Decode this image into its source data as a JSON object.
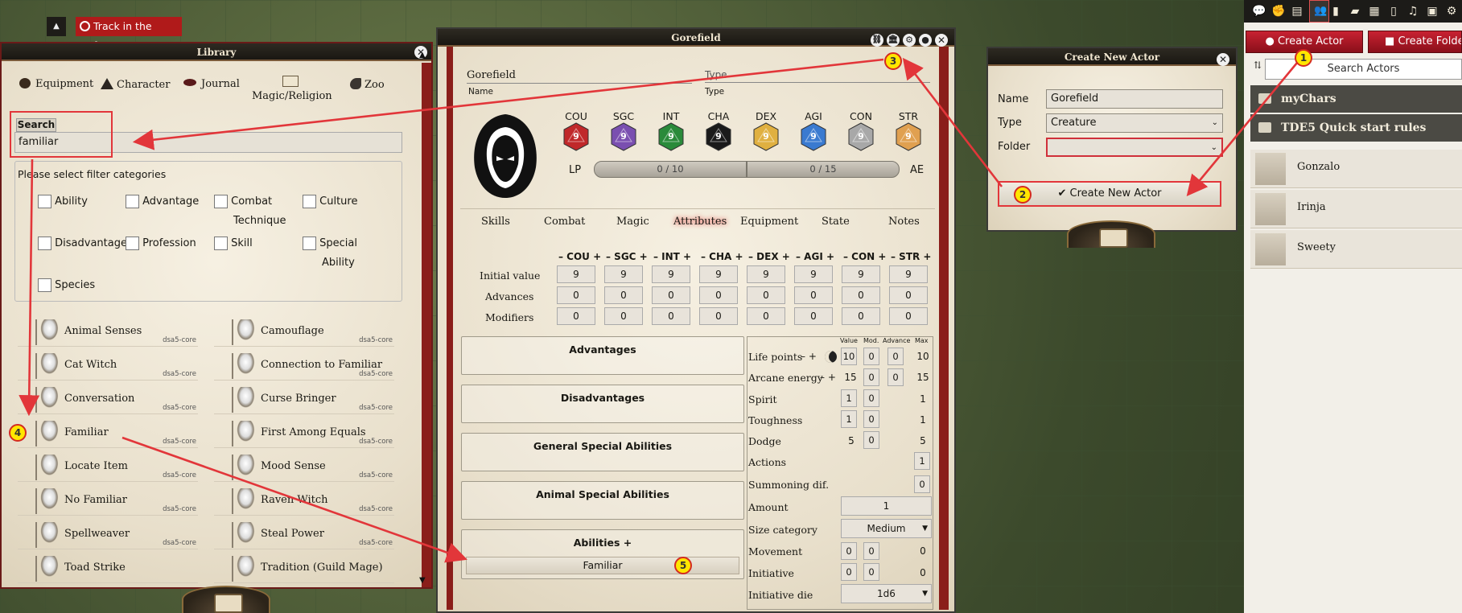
{
  "topbar": {
    "scene_tab": "Track in the forest",
    "collapse": "▲"
  },
  "library": {
    "title": "Library",
    "categories": [
      "Equipment",
      "Character",
      "Journal",
      "Magic/Religion",
      "Zoo"
    ],
    "search_label": "Search",
    "search_value": "familiar",
    "filter_title": "Please select filter categories",
    "filters": [
      "Ability",
      "Advantage",
      "Combat",
      "Technique",
      "Culture",
      "Disadvantage",
      "Profession",
      "Skill",
      "Special",
      "Ability",
      "Species"
    ],
    "items": [
      {
        "name": "Animal Senses",
        "src": "dsa5-core"
      },
      {
        "name": "Camouflage",
        "src": "dsa5-core"
      },
      {
        "name": "Cat Witch",
        "src": "dsa5-core"
      },
      {
        "name": "Connection to Familiar",
        "src": "dsa5-core"
      },
      {
        "name": "Conversation",
        "src": "dsa5-core"
      },
      {
        "name": "Curse Bringer",
        "src": "dsa5-core"
      },
      {
        "name": "Familiar",
        "src": "dsa5-core"
      },
      {
        "name": "First Among Equals",
        "src": "dsa5-core"
      },
      {
        "name": "Locate Item",
        "src": "dsa5-core"
      },
      {
        "name": "Mood Sense",
        "src": "dsa5-core"
      },
      {
        "name": "No Familiar",
        "src": "dsa5-core"
      },
      {
        "name": "Raven Witch",
        "src": "dsa5-core"
      },
      {
        "name": "Spellweaver",
        "src": "dsa5-core"
      },
      {
        "name": "Steal Power",
        "src": "dsa5-core"
      },
      {
        "name": "Toad Strike",
        "src": ""
      },
      {
        "name": "Tradition (Guild Mage)",
        "src": ""
      }
    ]
  },
  "sheet": {
    "title": "Gorefield",
    "name_value": "Gorefield",
    "name_label": "Name",
    "type_value": "Type",
    "type_label": "Type",
    "attrs": [
      "COU",
      "SGC",
      "INT",
      "CHA",
      "DEX",
      "AGI",
      "CON",
      "STR"
    ],
    "die_value": "9",
    "die_colors": [
      "#c0282a",
      "#7a4fb0",
      "#2a8a3a",
      "#1a1a1a",
      "#e0b040",
      "#3a7ad0",
      "#a8a8a8",
      "#e0a050"
    ],
    "lp_label": "LP",
    "ae_label": "AE",
    "lp_bar": "0 / 10",
    "ae_bar": "0 / 15",
    "tabs": [
      "Skills",
      "Combat",
      "Magic",
      "Attributes",
      "Equipment",
      "State",
      "Notes"
    ],
    "attr_headers": [
      "– COU +",
      "– SGC +",
      "– INT +",
      "– CHA +",
      "– DEX +",
      "– AGI +",
      "– CON +",
      "– STR +"
    ],
    "row_labels": [
      "Initial value",
      "Advances",
      "Modifiers"
    ],
    "initial": [
      "9",
      "9",
      "9",
      "9",
      "9",
      "9",
      "9",
      "9"
    ],
    "advances": [
      "0",
      "0",
      "0",
      "0",
      "0",
      "0",
      "0",
      "0"
    ],
    "modifiers": [
      "0",
      "0",
      "0",
      "0",
      "0",
      "0",
      "0",
      "0"
    ],
    "sections": [
      "Advantages",
      "Disadvantages",
      "General Special Abilities",
      "Animal Special Abilities",
      "Abilities +"
    ],
    "ability_item": "Familiar",
    "stat_heads": [
      "Value",
      "Mod.",
      "Advance",
      "Max"
    ],
    "stats": {
      "life": {
        "label": "Life points",
        "ctl": "– +",
        "value": "10",
        "mod": "0",
        "adv": "0",
        "max": "10"
      },
      "arcane": {
        "label": "Arcane energy",
        "ctl": "– +",
        "value": "15",
        "mod": "0",
        "adv": "0",
        "max": "15"
      },
      "spirit": {
        "label": "Spirit",
        "value": "1",
        "mod": "0",
        "max": "1"
      },
      "tough": {
        "label": "Toughness",
        "value": "1",
        "mod": "0",
        "max": "1"
      },
      "dodge": {
        "label": "Dodge",
        "value": "5",
        "mod": "0",
        "max": "5"
      },
      "actions": {
        "label": "Actions",
        "value": "1"
      },
      "summon": {
        "label": "Summoning dif.",
        "value": "0"
      },
      "amount": {
        "label": "Amount",
        "value": "1"
      },
      "size": {
        "label": "Size category",
        "value": "Medium"
      },
      "move": {
        "label": "Movement",
        "value": "0",
        "mod": "0",
        "max": "0"
      },
      "init": {
        "label": "Initiative",
        "value": "0",
        "mod": "0",
        "max": "0"
      },
      "initdie": {
        "label": "Initiative die",
        "value": "1d6"
      }
    }
  },
  "create": {
    "title": "Create New Actor",
    "name_label": "Name",
    "name_value": "Gorefield",
    "type_label": "Type",
    "type_value": "Creature",
    "folder_label": "Folder",
    "folder_value": "",
    "button": "Create New Actor"
  },
  "sidebar": {
    "create_actor": "Create Actor",
    "create_folder": "Create Folder",
    "search_placeholder": "Search Actors",
    "folders": [
      "myChars",
      "TDE5 Quick start rules"
    ],
    "actors": [
      "Gonzalo",
      "Irinja",
      "Sweety"
    ]
  },
  "callouts": [
    "1",
    "2",
    "3",
    "4",
    "5"
  ]
}
